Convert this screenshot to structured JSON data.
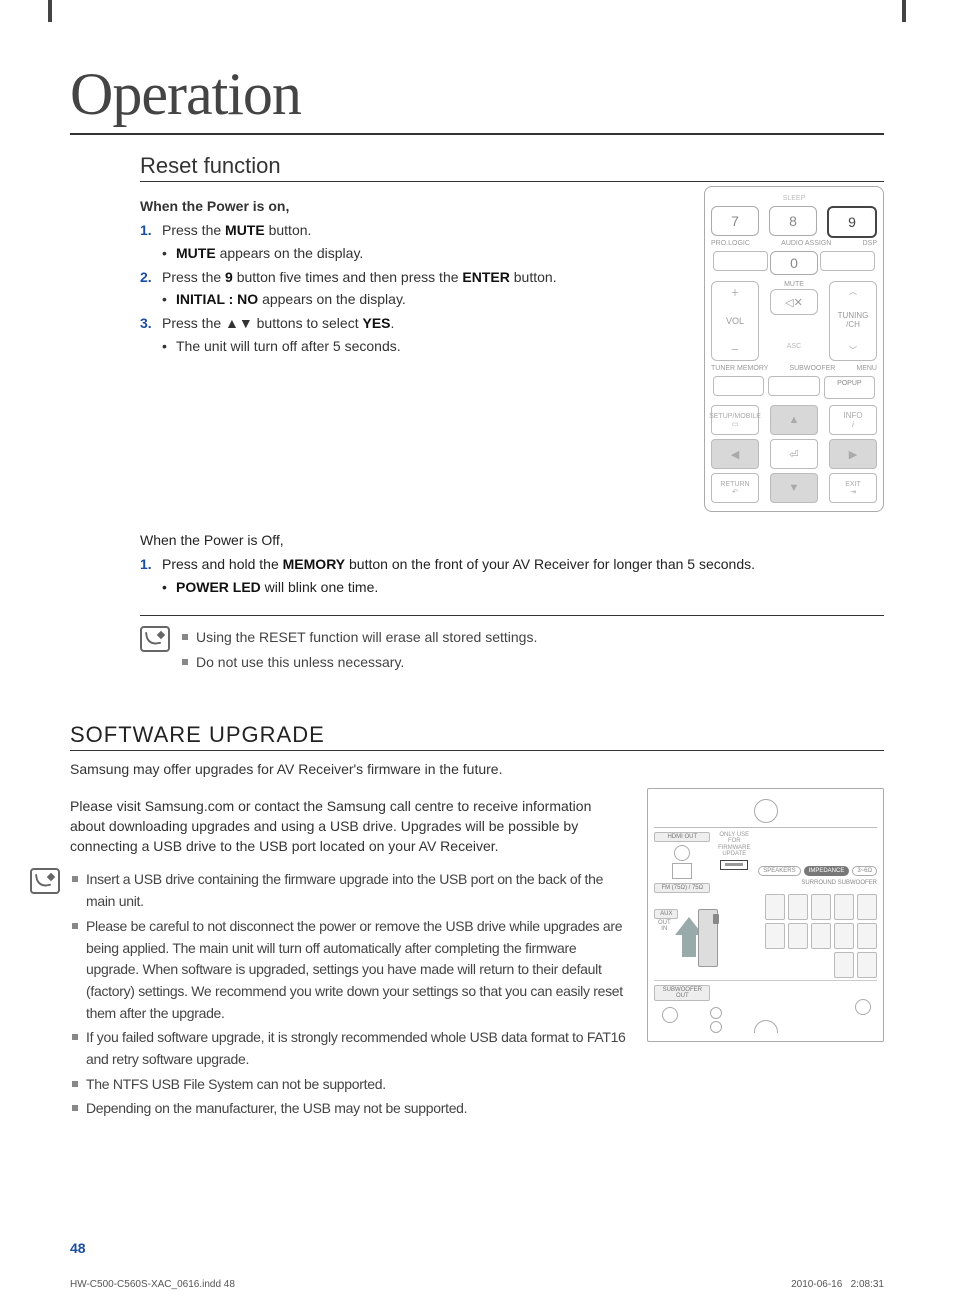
{
  "chapter": "Operation",
  "reset": {
    "title": "Reset function",
    "on": {
      "heading": "When the Power is on,",
      "s1": {
        "bold": "MUTE",
        "after": "button.",
        "sub_bold": "MUTE",
        "sub_after": "appears on the display."
      },
      "s2": {
        "b1": "9",
        "mid": "button five times and then press the",
        "b2": "ENTER",
        "after": "button.",
        "sub_bold": "INITIAL : NO",
        "sub_after": "appears on the display."
      },
      "s3": {
        "arrows": "▲▼",
        "mid": "buttons to select",
        "bold": "YES",
        "sub": "The unit will turn off after 5 seconds."
      }
    },
    "off": {
      "heading": "When the Power is Off,",
      "s1": {
        "bold": "MEMORY",
        "after": "button on the front of your AV Receiver for longer than 5 seconds.",
        "sub_bold": "POWER LED",
        "sub_after": "will blink one time."
      }
    },
    "notes": [
      "Using the RESET function will erase all stored settings.",
      "Do not use this unless necessary."
    ]
  },
  "software": {
    "title": "SOFTWARE UPGRADE",
    "p1": "Samsung may offer upgrades for AV Receiver's firmware in the future.",
    "p2": "Please visit Samsung.com or contact the Samsung call centre to receive information about downloading upgrades and using a USB drive. Upgrades will be possible by connecting a USB drive to the USB port located on your AV Receiver.",
    "notes": [
      "Insert a USB drive containing the firmware upgrade into the USB port on the back of the main unit.",
      "Please be careful to not disconnect the power or remove the USB drive while upgrades are being applied. The main unit will turn off automatically after completing the firmware upgrade. When software is upgraded, settings you have made will return to their default (factory) settings. We recommend you write down your settings so that you can easily reset them after the upgrade.",
      "If you failed software upgrade, it is strongly recommended whole USB data format to FAT16 and retry software upgrade.",
      "The NTFS USB File System can not be supported.",
      "Depending on the manufacturer, the USB may not be supported."
    ]
  },
  "remote": {
    "top_label": "SLEEP",
    "k7": "7",
    "k8": "8",
    "k9": "9",
    "k0": "0",
    "l1": "PRO.LOGIC",
    "l2": "AUDIO ASSIGN",
    "l3": "DSP",
    "vol": "VOL",
    "mute_lbl": "MUTE",
    "asc": "ASC",
    "tune": "TUNING /CH",
    "b1": "TUNER MEMORY",
    "b2": "SUBWOOFER",
    "b3": "MENU",
    "popup": "POPUP",
    "setup": "SETUP/MOBILE",
    "info": "INFO",
    "return": "RETURN",
    "exit": "EXIT"
  },
  "rear": {
    "hdmi": "HDMI OUT",
    "fm": "FM (75Ω) / 75Ω",
    "usb_lbl": "ONLY USE FOR FIRMWARE UPDATE",
    "speaker": "SPEAKERS",
    "imp": "IMPEDANCE",
    "ohm": "3~6Ω",
    "surround": "SURROUND  SUBWOOFER",
    "subout": "SUBWOOFER OUT"
  },
  "page": {
    "num": "48",
    "file": "HW-C500-C560S-XAC_0616.indd   48",
    "date": "2010-06-16",
    "time": "2:08:31"
  }
}
